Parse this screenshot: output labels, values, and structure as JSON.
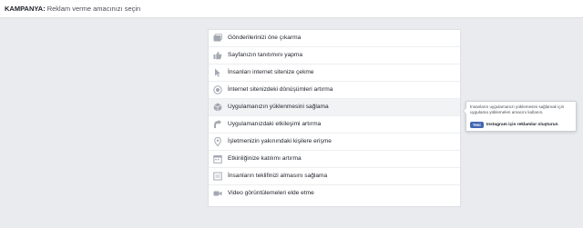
{
  "header": {
    "label": "KAMPANYA:",
    "subtitle": "Reklam verme amacınızı seçin"
  },
  "objectives": [
    {
      "label": "Gönderilerinizi öne çıkarma",
      "icon": "post-boost-icon"
    },
    {
      "label": "Sayfanızın tanıtımını yapma",
      "icon": "thumbs-up-icon"
    },
    {
      "label": "İnsanları internet sitenize çekme",
      "icon": "cursor-icon"
    },
    {
      "label": "İnternet sitenizdeki dönüşümleri artırma",
      "icon": "globe-icon"
    },
    {
      "label": "Uygulamanızın yüklenmesini sağlama",
      "icon": "app-cube-icon"
    },
    {
      "label": "Uygulamanızdaki etkileşimi artırma",
      "icon": "app-engagement-icon"
    },
    {
      "label": "İşletmenizin yakınındaki kişilere erişme",
      "icon": "location-pin-icon"
    },
    {
      "label": "Etkinliğinize katılımı artırma",
      "icon": "calendar-icon"
    },
    {
      "label": "İnsanların teklifinizi almasını sağlama",
      "icon": "offer-tag-icon"
    },
    {
      "label": "Video görüntülemeleri elde etme",
      "icon": "video-camera-icon"
    }
  ],
  "active_index": 4,
  "tooltip": {
    "description": "İnsanların uygulamanızı yüklemesini sağlamak için uygulama yüklemeleri amacını kullanın.",
    "badge": "Yeni",
    "link": "Instagram için reklamlar oluşturun"
  },
  "colors": {
    "background": "#e9ebee",
    "icon": "#a3a8b1",
    "badge": "#4267b2"
  }
}
